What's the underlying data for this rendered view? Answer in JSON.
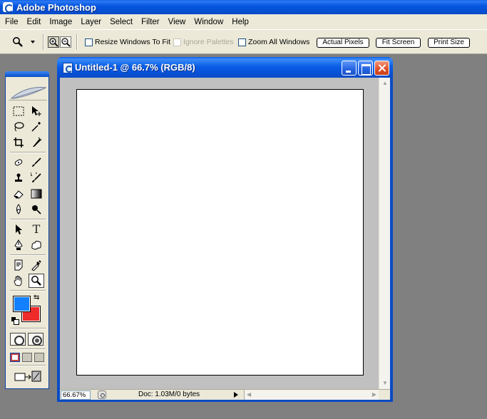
{
  "app": {
    "title": "Adobe Photoshop"
  },
  "menu": [
    "File",
    "Edit",
    "Image",
    "Layer",
    "Select",
    "Filter",
    "View",
    "Window",
    "Help"
  ],
  "options": {
    "tool_icon": "zoom-icon",
    "zoom_in_icon": "zoom-in-icon",
    "zoom_out_icon": "zoom-out-icon",
    "resize_windows": {
      "label": "Resize Windows To Fit",
      "checked": false
    },
    "ignore_palettes": {
      "label": "Ignore Palettes",
      "checked": false,
      "enabled": false
    },
    "zoom_all_windows": {
      "label": "Zoom All Windows",
      "checked": false
    },
    "buttons": {
      "actual_pixels": "Actual Pixels",
      "fit_screen": "Fit Screen",
      "print_size": "Print Size"
    }
  },
  "toolbox": {
    "tools": [
      "rectangular-marquee-icon",
      "move-icon",
      "lasso-icon",
      "magic-wand-icon",
      "crop-icon",
      "slice-icon",
      "healing-brush-icon",
      "brush-icon",
      "clone-stamp-icon",
      "history-brush-icon",
      "eraser-icon",
      "gradient-icon",
      "blur-icon",
      "dodge-icon",
      "path-selection-icon",
      "type-icon",
      "pen-icon",
      "custom-shape-icon",
      "notes-icon",
      "eyedropper-icon",
      "hand-icon",
      "zoom-tool-icon"
    ],
    "active_tool": "zoom-tool-icon",
    "foreground_color": "#1280FF",
    "background_color": "#EE2A2A"
  },
  "document": {
    "title": "Untitled-1 @ 66.7% (RGB/8)",
    "canvas_color": "#FFFFFF",
    "zoom": "66.67%",
    "status": "Doc: 1.03M/0 bytes"
  }
}
